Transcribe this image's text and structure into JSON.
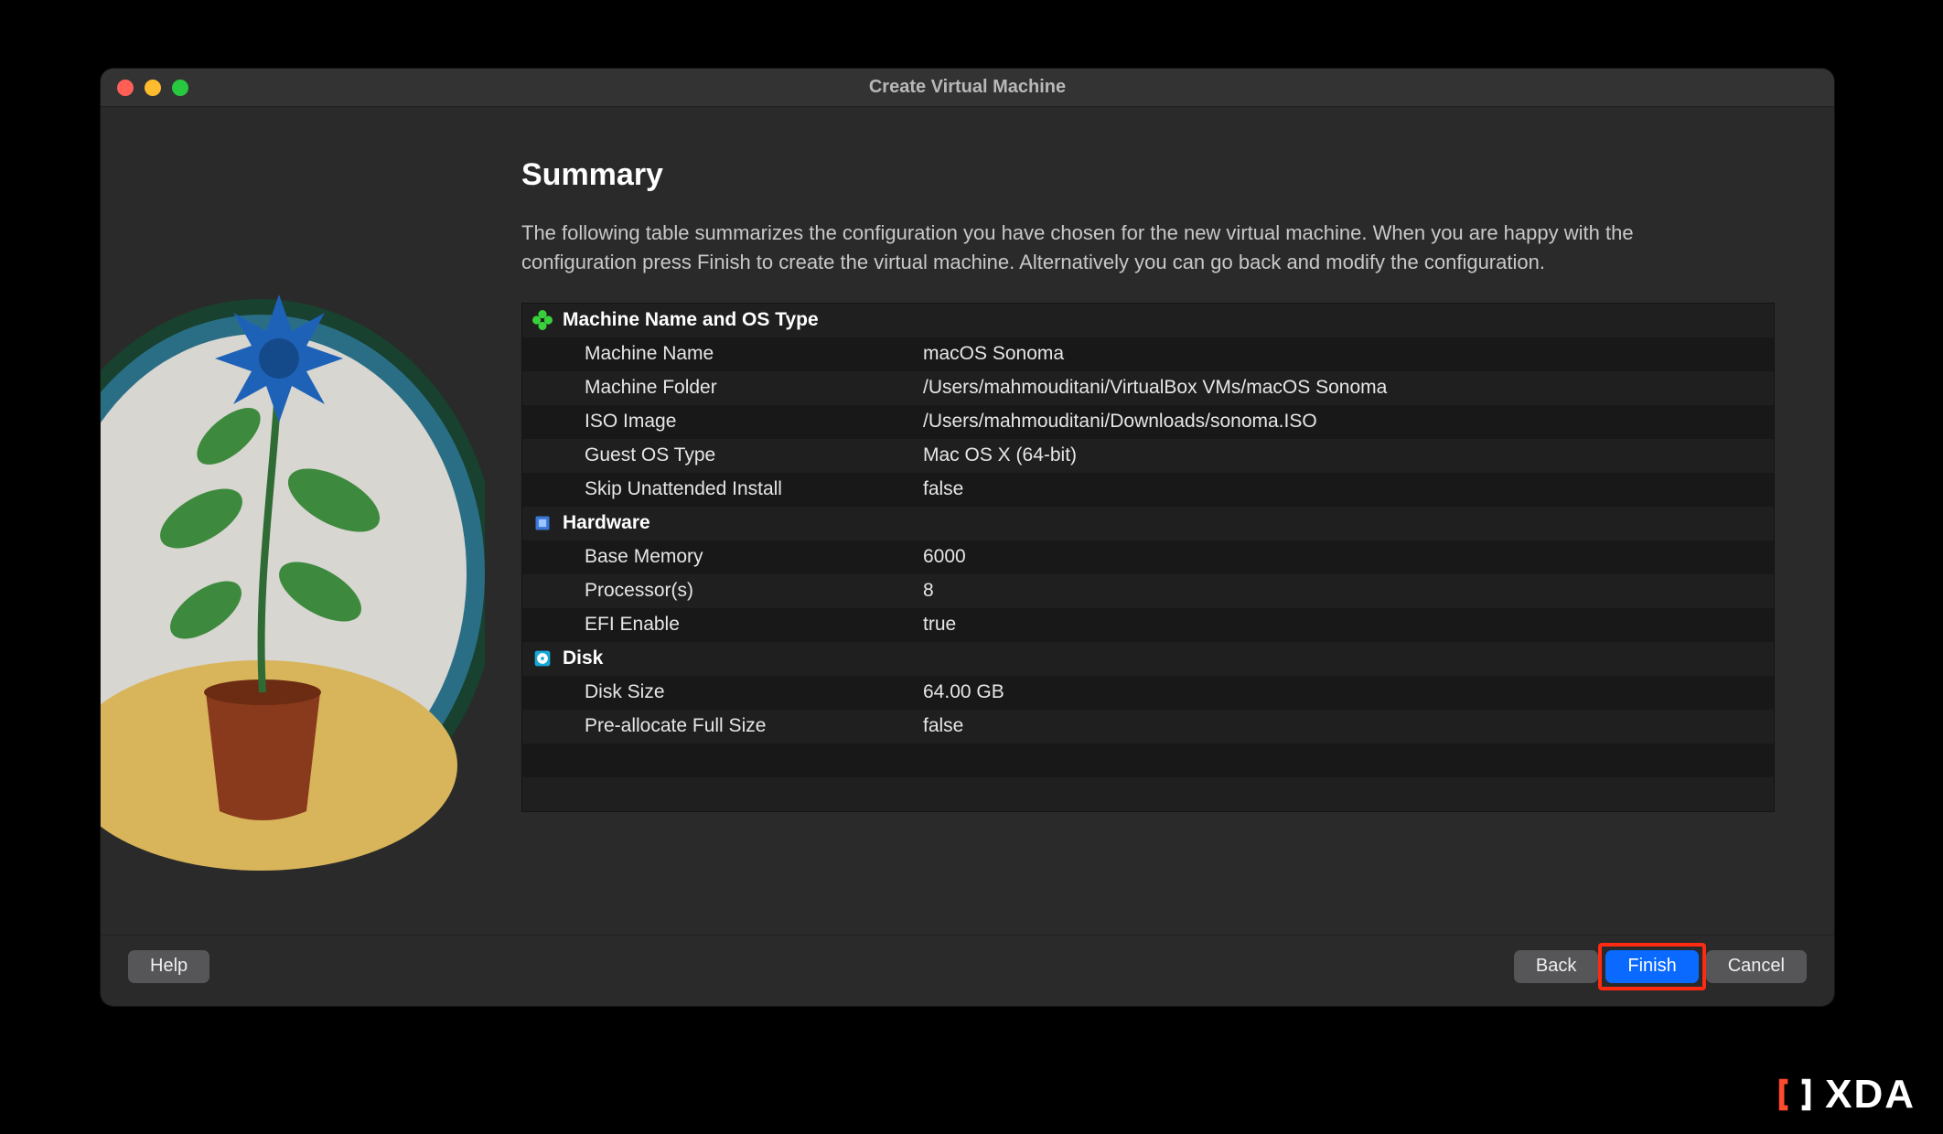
{
  "window": {
    "title": "Create Virtual Machine"
  },
  "summary": {
    "heading": "Summary",
    "description": "The following table summarizes the configuration you have chosen for the new virtual machine. When you are happy with the configuration press Finish to create the virtual machine. Alternatively you can go back and modify the configuration."
  },
  "sections": {
    "machine": {
      "title": "Machine Name and OS Type",
      "rows": {
        "name_label": "Machine Name",
        "name_value": "macOS Sonoma",
        "folder_label": "Machine Folder",
        "folder_value": "/Users/mahmouditani/VirtualBox VMs/macOS Sonoma",
        "iso_label": "ISO Image",
        "iso_value": "/Users/mahmouditani/Downloads/sonoma.ISO",
        "guest_label": "Guest OS Type",
        "guest_value": "Mac OS X (64-bit)",
        "skip_label": "Skip Unattended Install",
        "skip_value": "false"
      }
    },
    "hardware": {
      "title": "Hardware",
      "rows": {
        "mem_label": "Base Memory",
        "mem_value": "6000",
        "proc_label": "Processor(s)",
        "proc_value": "8",
        "efi_label": "EFI Enable",
        "efi_value": "true"
      }
    },
    "disk": {
      "title": "Disk",
      "rows": {
        "size_label": "Disk Size",
        "size_value": "64.00 GB",
        "prealloc_label": "Pre-allocate Full Size",
        "prealloc_value": "false"
      }
    }
  },
  "buttons": {
    "help": "Help",
    "back": "Back",
    "finish": "Finish",
    "cancel": "Cancel"
  },
  "watermark": {
    "text": "XDA"
  }
}
